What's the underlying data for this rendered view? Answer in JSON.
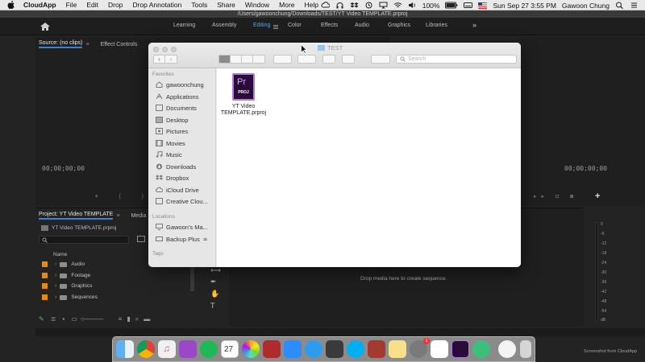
{
  "menubar": {
    "app_name": "CloudApp",
    "menus": [
      "File",
      "Edit",
      "Drop",
      "Drop Annotation",
      "Tools",
      "Share",
      "Window",
      "More",
      "Help"
    ],
    "battery": "100%",
    "datetime": "Sun Sep 27  3:55 PM",
    "user": "Gawoon Chung"
  },
  "premiere": {
    "path": "/Users/gawoonchung/Downloads/TEST/YT Video TEMPLATE.prproj",
    "workspaces": [
      "Learning",
      "Assembly",
      "Editing",
      "Color",
      "Effects",
      "Audio",
      "Graphics",
      "Libraries"
    ],
    "active_workspace": "Editing",
    "more": "»",
    "source_tab": "Source: (no clips)",
    "effect_controls_tab": "Effect Controls",
    "timecode_left": "00;00;00;00",
    "timecode_right": "00;00;00;00",
    "project_tab": "Project: YT Video TEMPLATE",
    "media_browser_tab": "Media Brow",
    "project_file": "YT Video TEMPLATE.prproj",
    "name_col": "Name",
    "bins": [
      "Audio",
      "Footage",
      "Graphics",
      "Sequences"
    ],
    "drop_hint": "Drop media here to create sequence.",
    "meter_labels": [
      "0",
      "-6",
      "-12",
      "-18",
      "-24",
      "-30",
      "-36",
      "-42",
      "-48",
      "-54",
      "dB"
    ]
  },
  "finder": {
    "title": "TEST",
    "search_placeholder": "Search",
    "favorites_label": "Favorites",
    "favorites": [
      {
        "label": "gawoonchung",
        "icon": "home-icon"
      },
      {
        "label": "Applications",
        "icon": "applications-icon"
      },
      {
        "label": "Documents",
        "icon": "documents-icon"
      },
      {
        "label": "Desktop",
        "icon": "desktop-icon"
      },
      {
        "label": "Pictures",
        "icon": "pictures-icon"
      },
      {
        "label": "Movies",
        "icon": "movies-icon"
      },
      {
        "label": "Music",
        "icon": "music-icon"
      },
      {
        "label": "Downloads",
        "icon": "downloads-icon"
      },
      {
        "label": "Dropbox",
        "icon": "dropbox-icon"
      },
      {
        "label": "iCloud Drive",
        "icon": "icloud-icon"
      },
      {
        "label": "Creative Clou...",
        "icon": "creative-cloud-icon"
      }
    ],
    "locations_label": "Locations",
    "locations": [
      {
        "label": "Gawoon's Ma...",
        "icon": "computer-icon"
      },
      {
        "label": "Backup Plus",
        "icon": "drive-icon"
      }
    ],
    "tags_label": "Tags",
    "file": {
      "badge": "Pr",
      "ext": "PROJ",
      "name_line1": "YT Video",
      "name_line2": "TEMPLATE.prproj"
    }
  },
  "dock": {
    "apps": [
      "finder",
      "chrome",
      "itunes",
      "podcasts",
      "spotify",
      "calendar",
      "photos",
      "photo-booth",
      "zoom",
      "messages",
      "find-my",
      "skype",
      "dictionary",
      "notes",
      "preferences",
      "slack",
      "premiere-pro",
      "send",
      "cloudapp",
      "trash"
    ],
    "calendar_day": "27",
    "badge": "1"
  },
  "watermark": "Screenshot from CloudApp"
}
